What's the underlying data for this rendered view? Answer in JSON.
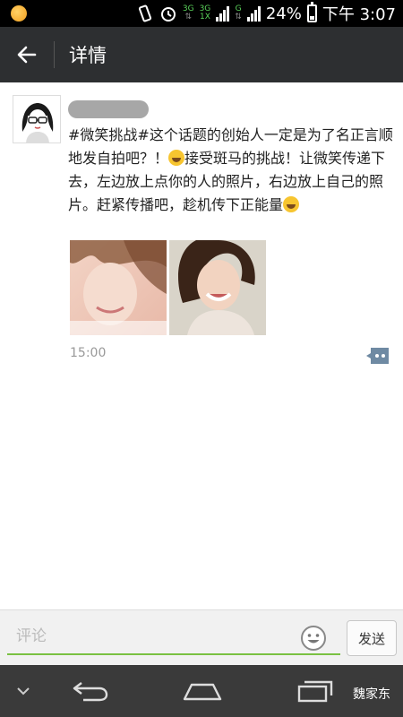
{
  "status_bar": {
    "net_label_1": "3G",
    "net_label_2": "3G",
    "net_label_3": "1X",
    "net_label_4": "G",
    "battery_percent": "24%",
    "time": "下午 3:07"
  },
  "title_bar": {
    "title": "详情"
  },
  "post": {
    "text_part1": "#微笑挑战#这个话题的创始人一定是为了名正言顺地发自拍吧？！",
    "text_part2": "接受斑马的挑战！让微笑传递下去，左边放上点你的人的照片，右边放上自己的照片。赶紧传播吧，趁机传下正能量",
    "time": "15:00"
  },
  "comment_bar": {
    "placeholder": "评论",
    "send_label": "发送"
  },
  "nav_bar": {
    "watermark": "魏家东"
  },
  "colors": {
    "status_bg": "#000000",
    "title_bg": "#2d2f31",
    "accent_green": "#7ac143",
    "nav_bg": "#3a3a3a"
  }
}
